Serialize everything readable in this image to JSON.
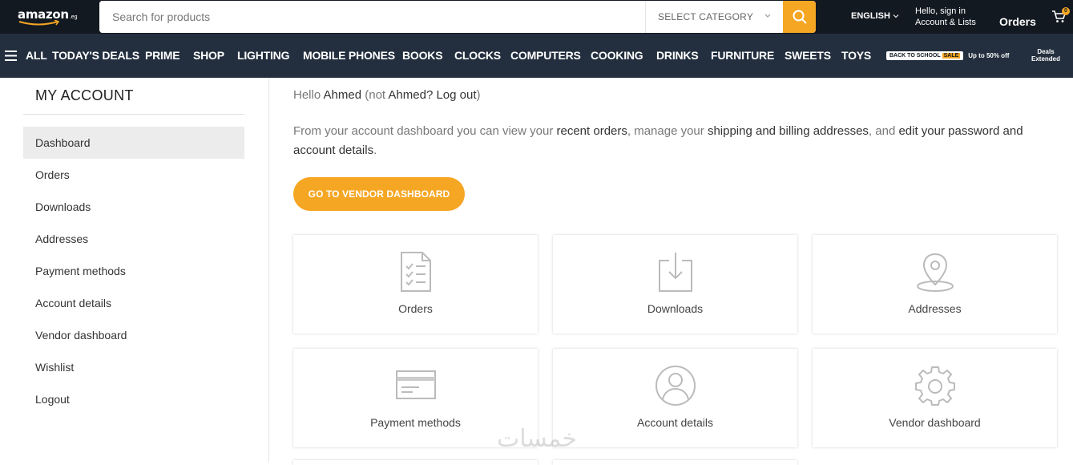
{
  "header": {
    "logo_text": "amazon",
    "logo_tld": ".eg",
    "search_placeholder": "Search for products",
    "category_label": "SELECT CATEGORY",
    "language": "ENGLISH",
    "signin_line1": "Hello, sign in",
    "signin_line2": "Account & Lists",
    "orders_label": "Orders",
    "cart_count": "0"
  },
  "nav": {
    "all_label": "ALL",
    "items": [
      "TODAY'S DEALS",
      "PRIME",
      "SHOP",
      "LIGHTING",
      "MOBILE PHONES",
      "BOOKS",
      "CLOCKS",
      "COMPUTERS",
      "COOKING",
      "DRINKS",
      "FURNITURE",
      "SWEETS",
      "TOYS"
    ],
    "promo_badge": "BACK TO SCHOOL",
    "promo_badge_sale": "SALE",
    "promo_offer": "Up to 50% off",
    "promo_deals_line1": "Deals",
    "promo_deals_line2": "Extended"
  },
  "sidebar": {
    "title": "MY ACCOUNT",
    "items": [
      {
        "label": "Dashboard",
        "active": true
      },
      {
        "label": "Orders"
      },
      {
        "label": "Downloads"
      },
      {
        "label": "Addresses"
      },
      {
        "label": "Payment methods"
      },
      {
        "label": "Account details"
      },
      {
        "label": "Vendor dashboard"
      },
      {
        "label": "Wishlist"
      },
      {
        "label": "Logout"
      }
    ]
  },
  "main": {
    "hello_prefix": "Hello ",
    "hello_name": "Ahmed",
    "hello_mid": " (not ",
    "hello_name2": "Ahmed?",
    "hello_logout": "Log out",
    "hello_suffix": ")",
    "intro_1": "From your account dashboard you can view your ",
    "intro_link1": "recent orders",
    "intro_2": ", manage your ",
    "intro_link2": "shipping and billing addresses",
    "intro_3": ", and ",
    "intro_link3": "edit your password and account details",
    "intro_4": ".",
    "vendor_button": "GO TO VENDOR DASHBOARD",
    "cards": [
      {
        "label": "Orders",
        "icon": "orders-icon"
      },
      {
        "label": "Downloads",
        "icon": "download-icon"
      },
      {
        "label": "Addresses",
        "icon": "location-pin-icon"
      },
      {
        "label": "Payment methods",
        "icon": "credit-card-icon"
      },
      {
        "label": "Account details",
        "icon": "user-icon"
      },
      {
        "label": "Vendor dashboard",
        "icon": "gear-icon"
      }
    ]
  },
  "watermark": "خمسات",
  "colors": {
    "topbar": "#131921",
    "navbar": "#232f3e",
    "accent": "#f5a623"
  }
}
